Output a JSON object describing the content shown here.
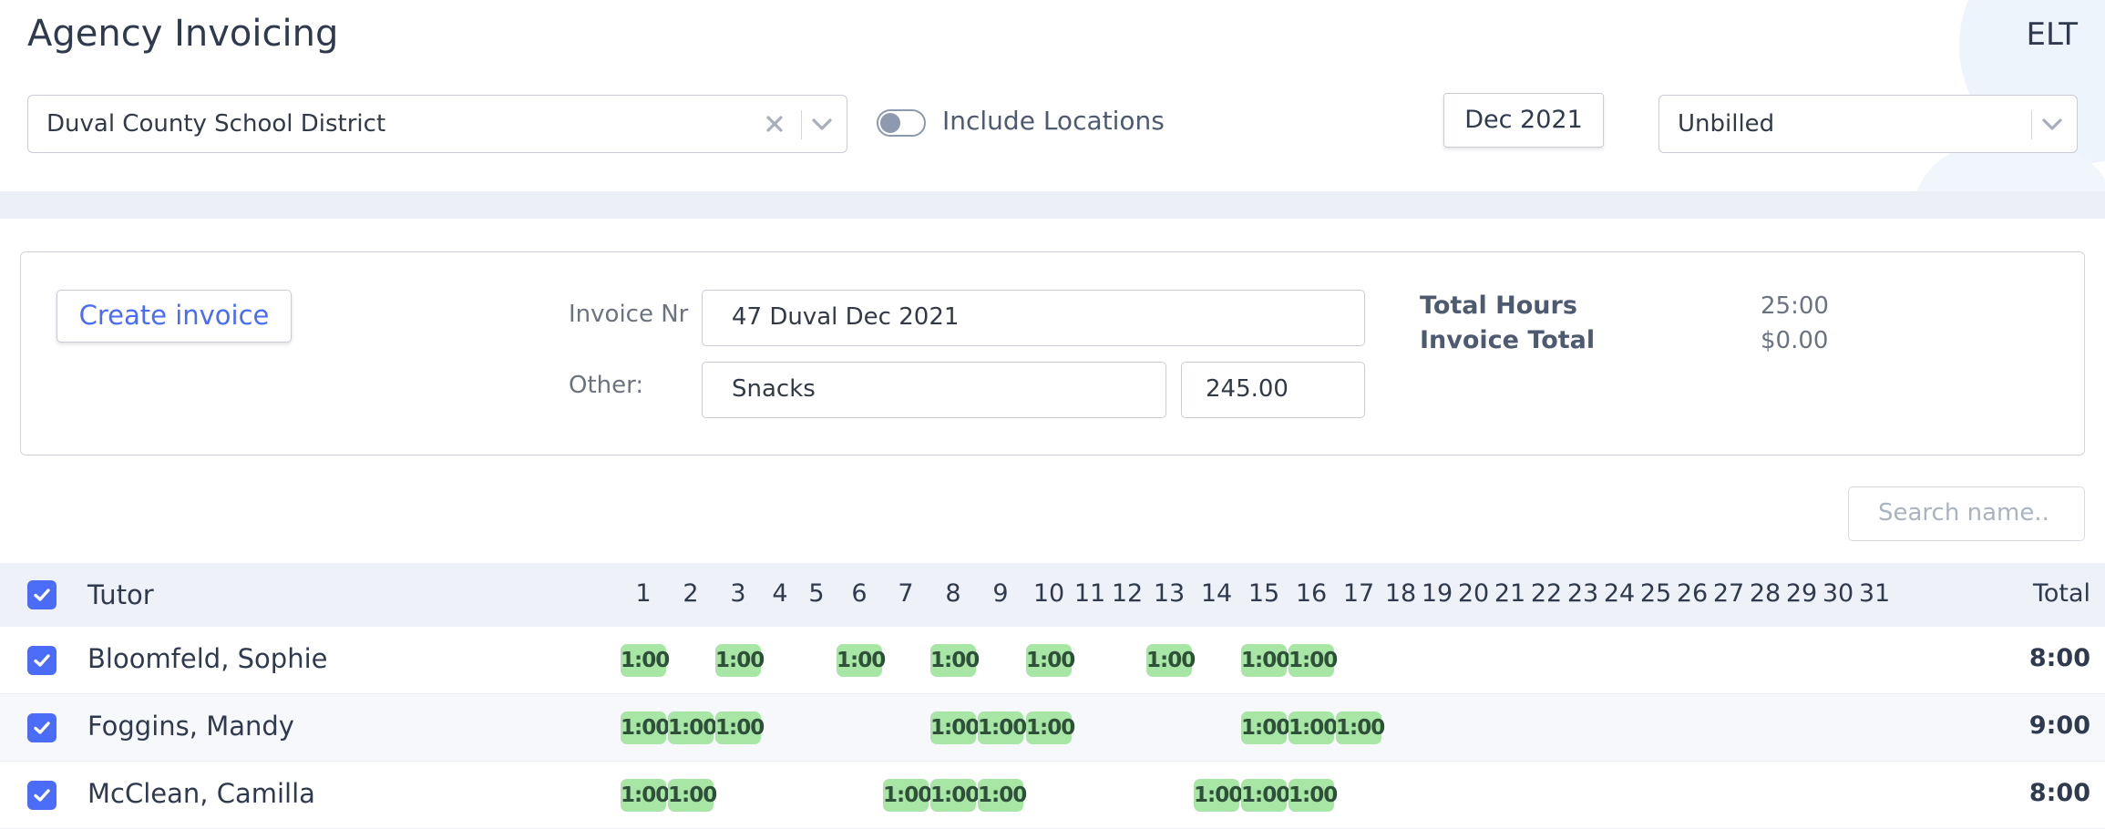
{
  "header": {
    "title": "Agency Invoicing",
    "brand": "ELT",
    "agency_select_value": "Duval County School District",
    "include_locations_label": "Include Locations",
    "include_locations_on": false,
    "month_label": "Dec 2021",
    "status_select_value": "Unbilled"
  },
  "invoice": {
    "create_label": "Create invoice",
    "nr_label": "Invoice Nr",
    "nr_value": "47 Duval Dec 2021",
    "other_label": "Other:",
    "other_desc": "Snacks",
    "other_amount": "245.00",
    "total_hours_label": "Total Hours",
    "total_hours_value": "25:00",
    "invoice_total_label": "Invoice Total",
    "invoice_total_value": "$0.00"
  },
  "search": {
    "placeholder": "Search name.."
  },
  "table": {
    "tutor_header": "Tutor",
    "total_header": "Total",
    "days": [
      "1",
      "2",
      "3",
      "4",
      "5",
      "6",
      "7",
      "8",
      "9",
      "10",
      "11",
      "12",
      "13",
      "14",
      "15",
      "16",
      "17",
      "18",
      "19",
      "20",
      "21",
      "22",
      "23",
      "24",
      "25",
      "26",
      "27",
      "28",
      "29",
      "30",
      "31"
    ],
    "rows": [
      {
        "name": "Bloomfeld, Sophie",
        "checked": true,
        "entries": [
          1,
          3,
          6,
          8,
          10,
          13,
          15,
          16
        ],
        "entry_label": "1:00",
        "total": "8:00"
      },
      {
        "name": "Foggins, Mandy",
        "checked": true,
        "entries": [
          1,
          2,
          3,
          8,
          9,
          10,
          15,
          16,
          17
        ],
        "entry_label": "1:00",
        "total": "9:00"
      },
      {
        "name": "McClean, Camilla",
        "checked": true,
        "entries": [
          1,
          2,
          7,
          8,
          9,
          14,
          15,
          16
        ],
        "entry_label": "1:00",
        "total": "8:00"
      }
    ]
  },
  "colors": {
    "accent": "#4a6cf7",
    "hours_pill": "#a8e6a6",
    "header_band": "#eef1f7"
  }
}
